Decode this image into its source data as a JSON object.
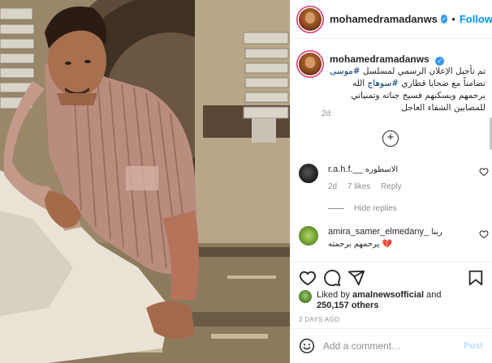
{
  "post": {
    "username": "mohamedramadanws",
    "verified_mark": "✓",
    "separator": "•",
    "follow_label": "Follow"
  },
  "caption": {
    "username": "mohamedramadanws",
    "text_part1": "تم تأجيل الإعلان الرسمي لمسلسل ",
    "hashtag1": "#موسى",
    "text_part2": " تضامناً مع ضحايا قطاري ",
    "hashtag2": "#سوهاج",
    "text_part3": " الله يرحمهم ويسكنهم فسيح جناته وتمنياتي للمصابين الشفاء العاجل",
    "time": "2d"
  },
  "load_more_symbol": "+",
  "comments": [
    {
      "username": "r.a.h.f.__",
      "text": "الاسطوره",
      "time": "2d",
      "likes": "7 likes",
      "reply_label": "Reply"
    },
    {
      "username": "amira_samer_elmedany_",
      "text": "ربنا يرحمهم برحمته 💔",
      "time": "",
      "likes": "",
      "reply_label": ""
    }
  ],
  "hide_replies_label": "Hide replies",
  "icons": [
    "heart-icon",
    "comment-icon",
    "share-icon",
    "bookmark-icon",
    "emoji-icon",
    "plus-icon"
  ],
  "likes": {
    "prefix": "Liked by ",
    "user": "amalnewsofficial",
    "middle": " and",
    "count": "250,157 others"
  },
  "time_ago": "2 DAYS AGO",
  "add_comment": {
    "placeholder": "Add a comment…",
    "post_label": "Post"
  },
  "colors": {
    "link_blue": "#0095f6",
    "hashtag": "#00376b",
    "muted": "#8e8e8e",
    "post_disabled": "#b2dffc"
  }
}
